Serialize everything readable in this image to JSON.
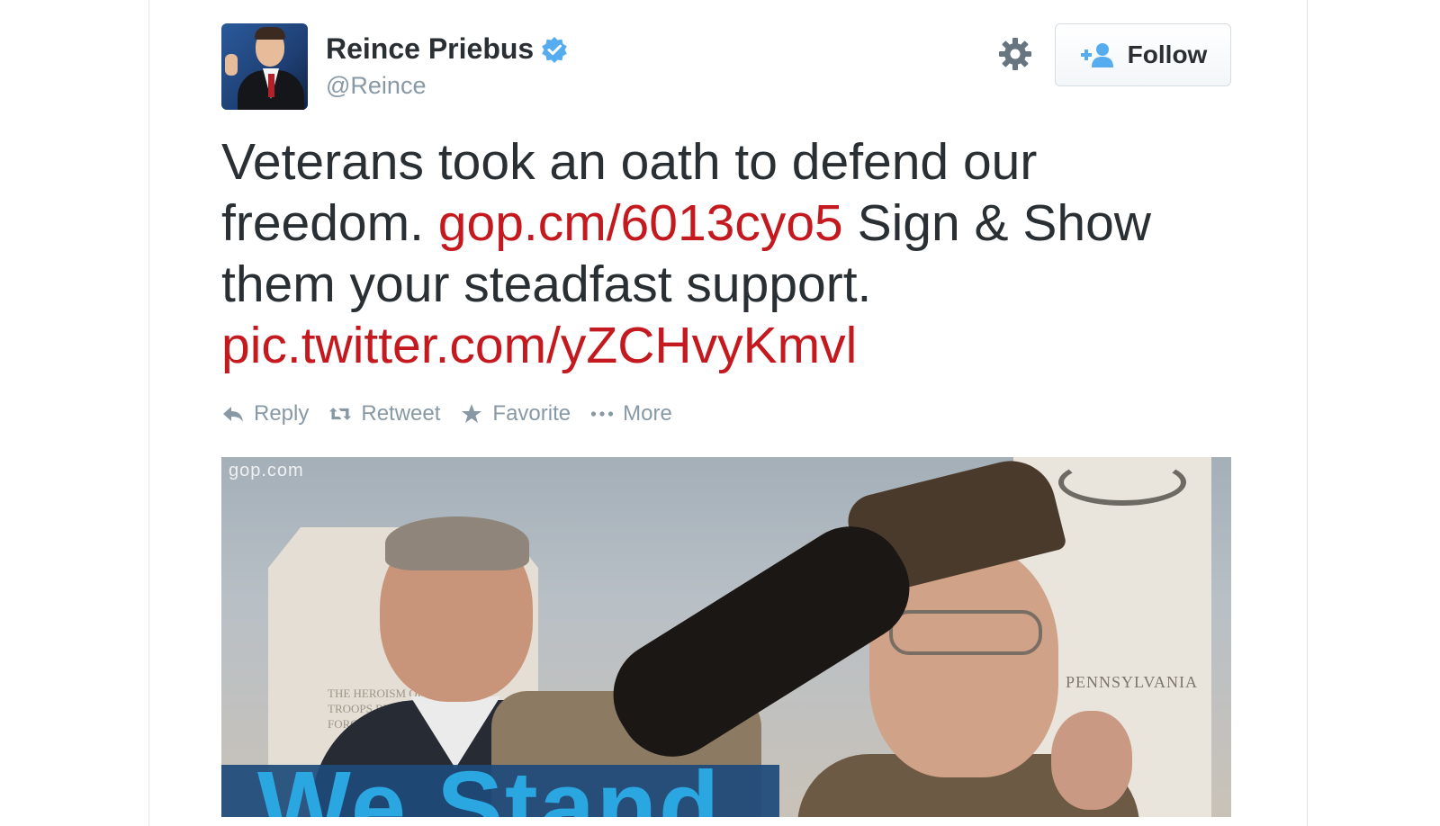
{
  "profile": {
    "name": "Reince Priebus",
    "handle": "@Reince",
    "verified": true
  },
  "header": {
    "follow_label": "Follow",
    "settings_icon": "gear-icon",
    "follow_icon": "follow-user-plus-icon"
  },
  "tweet": {
    "text_1": "Veterans took an oath to defend our freedom.",
    "link_1": "gop.cm/6013cyo5",
    "text_2": "Sign & Show them your steadfast support.",
    "link_2": "pic.twitter.com/yZCHvyKmvl"
  },
  "actions": [
    {
      "label": "Reply",
      "icon": "reply-icon"
    },
    {
      "label": "Retweet",
      "icon": "retweet-icon"
    },
    {
      "label": "Favorite",
      "icon": "star-icon"
    },
    {
      "label": "More",
      "icon": "more-dots-icon"
    }
  ],
  "media": {
    "watermark": "gop.com",
    "monument_inscription": "The Heroism of Troops by the Force",
    "sign_text": "PENNSYLVANIA",
    "banner_text": "We Stand"
  },
  "colors": {
    "link": "#c41a1f",
    "text": "#292f33",
    "muted": "#8899a6",
    "verified": "#55acee",
    "follow_icon": "#55acee"
  }
}
